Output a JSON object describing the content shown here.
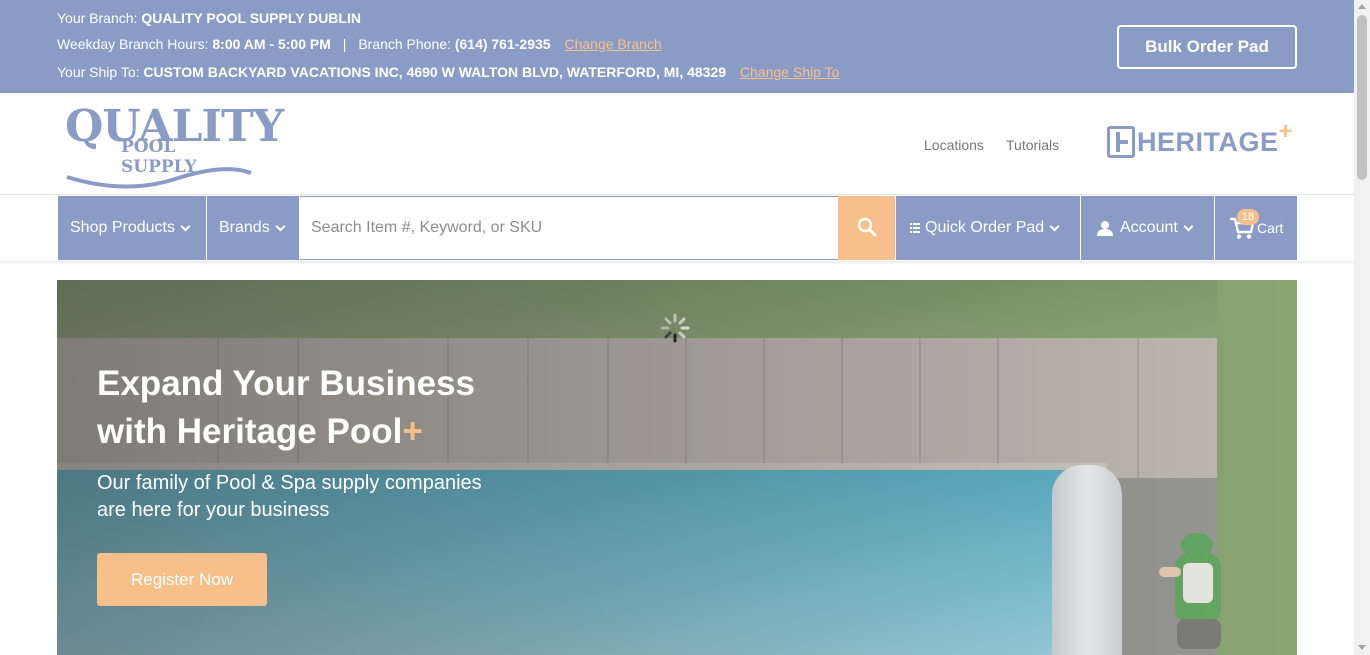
{
  "topbar": {
    "branch_label": "Your Branch:",
    "branch_name": "QUALITY POOL SUPPLY DUBLIN",
    "hours_label": "Weekday Branch Hours:",
    "hours_value": "8:00 AM - 5:00 PM",
    "separator": "|",
    "phone_label": "Branch Phone:",
    "phone_value": "(614) 761-2935",
    "change_branch": "Change Branch",
    "shipto_label": "Your Ship To:",
    "shipto_value": "CUSTOM BACKYARD VACATIONS INC, 4690 W WALTON BLVD, WATERFORD, MI, 48329",
    "change_shipto": "Change Ship To",
    "bulk_order_pad": "Bulk Order Pad"
  },
  "header": {
    "logo_line1": "QUALITY",
    "logo_line2": "POOL SUPPLY",
    "links": [
      "Locations",
      "Tutorials"
    ],
    "partner_logo": "HERITAGE",
    "partner_plus": "+"
  },
  "nav": {
    "shop_products": "Shop Products",
    "brands": "Brands",
    "search_placeholder": "Search Item #, Keyword, or SKU",
    "search_icon": "search-icon",
    "quick_order_pad": "Quick Order Pad",
    "account": "Account",
    "cart": "Cart",
    "cart_count": "18"
  },
  "hero": {
    "headline_line1": "Expand Your Business",
    "headline_line2": "with Heritage Pool",
    "headline_plus": "+",
    "subtext": "Our family of Pool & Spa supply companies  are here for your business",
    "cta": "Register Now"
  },
  "colors": {
    "brand": "#8a9cc6",
    "accent": "#f7c08a"
  }
}
